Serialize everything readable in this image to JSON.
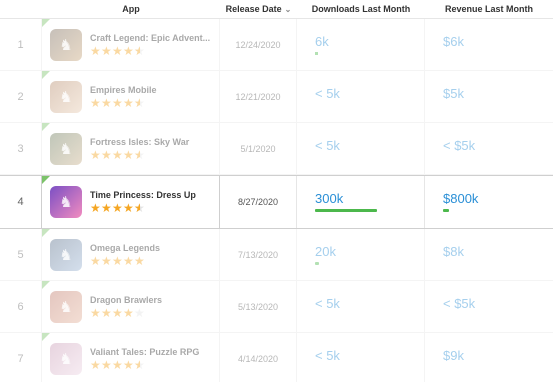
{
  "header": {
    "app": "App",
    "release_date": "Release Date",
    "downloads": "Downloads Last Month",
    "revenue": "Revenue Last Month",
    "sort_icon": "chevron-down-icon"
  },
  "colors": {
    "accent_blue": "#2a8fd6",
    "bar_green": "#4cb84c",
    "star_orange": "#f5a623",
    "corner_green": "#7cc36a"
  },
  "rows": [
    {
      "rank": "1",
      "name": "Craft Legend: Epic Advent...",
      "rating": 4.5,
      "date": "12/24/2020",
      "downloads": "6k",
      "downloads_fill": 0.02,
      "revenue": "$6k",
      "revenue_fill": 0,
      "active": false,
      "icon_colors": [
        "#7a6a5a",
        "#c9a67a"
      ]
    },
    {
      "rank": "2",
      "name": "Empires Mobile",
      "rating": 4.5,
      "date": "12/21/2020",
      "downloads": "< 5k",
      "downloads_fill": 0,
      "revenue": "$5k",
      "revenue_fill": 0,
      "active": false,
      "icon_colors": [
        "#b58a6a",
        "#e8cbb0"
      ]
    },
    {
      "rank": "3",
      "name": "Fortress Isles: Sky War",
      "rating": 4.5,
      "date": "5/1/2020",
      "downloads": "< 5k",
      "downloads_fill": 0,
      "revenue": "< $5k",
      "revenue_fill": 0,
      "active": false,
      "icon_colors": [
        "#6b7a5a",
        "#c9b08a"
      ]
    },
    {
      "rank": "4",
      "name": "Time Princess: Dress Up",
      "rating": 4.5,
      "date": "8/27/2020",
      "downloads": "300k",
      "downloads_fill": 1.0,
      "revenue": "$800k",
      "revenue_fill": 0.09,
      "active": true,
      "icon_colors": [
        "#7b4fc4",
        "#f28cc0"
      ]
    },
    {
      "rank": "5",
      "name": "Omega Legends",
      "rating": 5,
      "date": "7/13/2020",
      "downloads": "20k",
      "downloads_fill": 0.07,
      "revenue": "$8k",
      "revenue_fill": 0,
      "active": false,
      "icon_colors": [
        "#5a6f8a",
        "#9ab4d4"
      ]
    },
    {
      "rank": "6",
      "name": "Dragon Brawlers",
      "rating": 4.0,
      "date": "5/13/2020",
      "downloads": "< 5k",
      "downloads_fill": 0,
      "revenue": "< $5k",
      "revenue_fill": 0,
      "active": false,
      "icon_colors": [
        "#c07a6a",
        "#e4b29a"
      ]
    },
    {
      "rank": "7",
      "name": "Valiant Tales: Puzzle RPG",
      "rating": 4.5,
      "date": "4/14/2020",
      "downloads": "< 5k",
      "downloads_fill": 0,
      "revenue": "$9k",
      "revenue_fill": 0,
      "active": false,
      "icon_colors": [
        "#c89ab4",
        "#ecd3e2"
      ]
    }
  ]
}
